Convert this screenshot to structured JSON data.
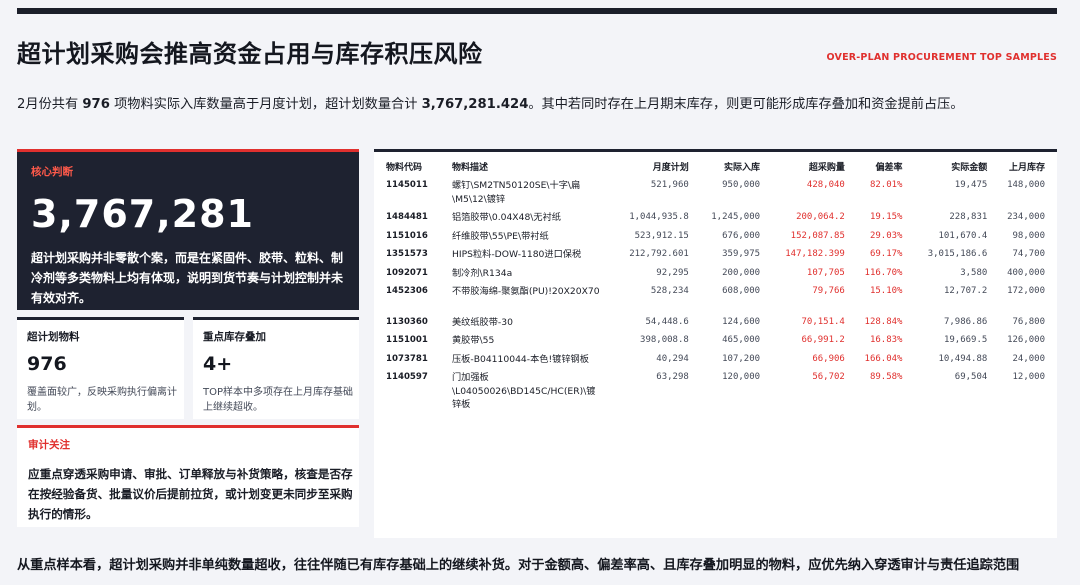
{
  "header": {
    "title": "超计划采购会推高资金占用与库存积压风险",
    "subtitle_en": "OVER-PLAN PROCUREMENT TOP SAMPLES"
  },
  "intro": {
    "p1": "2月份共有 ",
    "count": "976",
    "p2": " 项物料实际入库数量高于月度计划，超计划数量合计 ",
    "total": "3,767,281.424",
    "p3": "。其中若同时存在上月期末库存，则更可能形成库存叠加和资金提前占压。"
  },
  "core": {
    "tag": "核心判断",
    "value": "3,767,281",
    "desc": "超计划采购并非零散个案，而是在紧固件、胶带、粒料、制冷剂等多类物料上均有体现，说明到货节奏与计划控制并未有效对齐。"
  },
  "stats": [
    {
      "label": "超计划物料",
      "value": "976",
      "note": "覆盖面较广，反映采购执行偏离计划。"
    },
    {
      "label": "重点库存叠加",
      "value": "4+",
      "note": "TOP样本中多项存在上月库存基础上继续超收。"
    }
  ],
  "audit": {
    "tag": "审计关注",
    "text": "应重点穿透采购申请、审批、订单释放与补货策略，核查是否存在按经验备货、批量议价后提前拉货，或计划变更未同步至采购执行的情形。"
  },
  "table": {
    "columns": [
      "物料代码",
      "物料描述",
      "月度计划",
      "实际入库",
      "超采购量",
      "偏差率",
      "实际金额",
      "上月库存"
    ],
    "rows": [
      [
        "1145011",
        "螺钉\\SM2TN50120SE\\十字\\扁\\M5\\12\\镀锌",
        "521,960",
        "950,000",
        "428,040",
        "82.01%",
        "19,475",
        "148,000"
      ],
      [
        "1484481",
        "铝箔胶带\\0.04X48\\无衬纸",
        "1,044,935.8",
        "1,245,000",
        "200,064.2",
        "19.15%",
        "228,831",
        "234,000"
      ],
      [
        "1151016",
        "纤维胶带\\55\\PE\\带衬纸",
        "523,912.15",
        "676,000",
        "152,087.85",
        "29.03%",
        "101,670.4",
        "98,000"
      ],
      [
        "1351573",
        "HIPS粒料-DOW-1180进口保税",
        "212,792.601",
        "359,975",
        "147,182.399",
        "69.17%",
        "3,015,186.6",
        "74,700"
      ],
      [
        "1092071",
        "制冷剂\\R134a",
        "92,295",
        "200,000",
        "107,705",
        "116.70%",
        "3,580",
        "400,000"
      ],
      [
        "1452306",
        "不带胶海绵-聚氨酯(PU)!20X20X70",
        "528,234",
        "608,000",
        "79,766",
        "15.10%",
        "12,707.2",
        "172,000"
      ],
      [
        "1130360",
        "美纹纸胶带-30",
        "54,448.6",
        "124,600",
        "70,151.4",
        "128.84%",
        "7,986.86",
        "76,800"
      ],
      [
        "1151001",
        "黄胶带\\55",
        "398,008.8",
        "465,000",
        "66,991.2",
        "16.83%",
        "19,669.5",
        "126,000"
      ],
      [
        "1073781",
        "压板-B04110044-本色!镀锌钢板",
        "40,294",
        "107,200",
        "66,906",
        "166.04%",
        "10,494.88",
        "24,000"
      ],
      [
        "1140597",
        "门加强板\\L04050026\\BD145C/HC(ER)\\镀锌板",
        "63,298",
        "120,000",
        "56,702",
        "89.58%",
        "69,504",
        "12,000"
      ]
    ]
  },
  "footer": {
    "text": "从重点样本看，超计划采购并非单纯数量超收，往往伴随已有库存基础上的继续补货。对于金额高、偏差率高、且库存叠加明显的物料，应优先纳入穿透审计与责任追踪范围"
  },
  "colors": {
    "accent": "#e0302e",
    "dark": "#1e2230",
    "background": "#f3f4f8"
  }
}
